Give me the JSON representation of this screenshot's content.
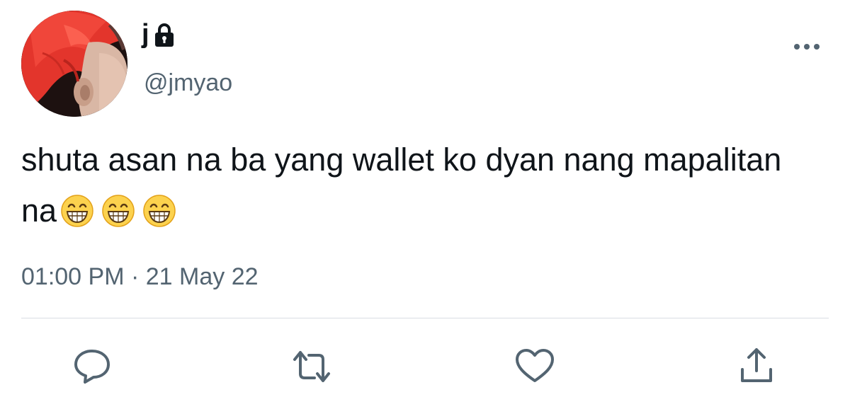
{
  "tweet": {
    "display_name": "j",
    "handle": "@jmyao",
    "text": "shuta asan na ba yang wallet ko dyan nang mapalitan na",
    "emojis": [
      "grinning-face-with-smiling-eyes",
      "grinning-face-with-smiling-eyes",
      "grinning-face-with-smiling-eyes"
    ],
    "time": "01:00 PM",
    "separator": " · ",
    "date": "21 May 22",
    "protected_account": true
  },
  "icons": {
    "lock": "lock-icon",
    "more": "more-horizontal-icon",
    "reply": "reply-bubble-icon",
    "retweet": "retweet-icon",
    "like": "heart-icon",
    "share": "share-upload-icon"
  },
  "colors": {
    "text_primary": "#0f1419",
    "text_secondary": "#536471",
    "divider": "#d9dee3",
    "avatar_hair": "#e8332a"
  }
}
